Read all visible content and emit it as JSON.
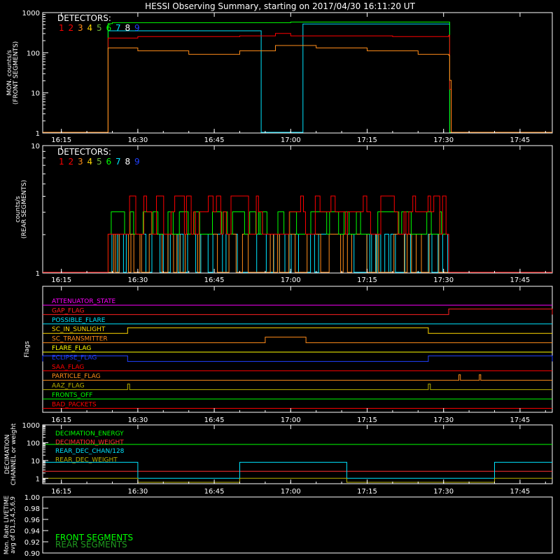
{
  "title": "HESSI Observing Summary, starting on 2017/04/30 16:11:20 UT",
  "time_axis": {
    "start": "16:11:20",
    "end": "17:51:20",
    "tick_times": [
      "16:15",
      "16:30",
      "16:45",
      "17:00",
      "17:15",
      "17:30",
      "17:45"
    ]
  },
  "detector_palette": [
    "#ff0000",
    "#ff0000",
    "#ff8c1a",
    "#ffd700",
    "#6db83c",
    "#00ff00",
    "#00e5ff",
    "#ffffff",
    "#2040ff"
  ],
  "chart_data": [
    {
      "name": "front",
      "type": "line",
      "ylabel": "MON. counts/s",
      "ylabel2": "(FRONT SEGMENTS)",
      "yscale": "log",
      "ylim": [
        1,
        1000
      ],
      "tick_labels": [
        "1",
        "10",
        "100",
        "1000"
      ],
      "legend_title": "DETECTORS:",
      "legend": [
        "1",
        "2",
        "3",
        "4",
        "5",
        "6",
        "7",
        "8",
        "9"
      ],
      "series": [
        {
          "color": "#00e5ff",
          "points": [
            [
              "16:11:20",
              1
            ],
            [
              "16:23:50",
              1
            ],
            [
              "16:24:10",
              350
            ],
            [
              "16:54",
              350
            ],
            [
              "16:54.2",
              1
            ],
            [
              "17:02.2",
              1
            ],
            [
              "17:02.4",
              520
            ],
            [
              "17:31",
              520
            ],
            [
              "17:31.2",
              1
            ],
            [
              "17:51:20",
              1
            ]
          ]
        },
        {
          "color": "#00ff00",
          "points": [
            [
              "16:11:20",
              1
            ],
            [
              "16:23:50",
              1
            ],
            [
              "16:24:10",
              530
            ],
            [
              "16:25",
              560
            ],
            [
              "17:00",
              580
            ],
            [
              "17:31",
              580
            ],
            [
              "17:31.2",
              1
            ],
            [
              "17:51:20",
              1
            ]
          ]
        },
        {
          "color": "#ff0000",
          "points": [
            [
              "16:11:20",
              1
            ],
            [
              "16:23:50",
              1
            ],
            [
              "16:24:10",
              230
            ],
            [
              "16:30",
              250
            ],
            [
              "16:50",
              260
            ],
            [
              "16:57",
              300
            ],
            [
              "17:00",
              260
            ],
            [
              "17:20",
              250
            ],
            [
              "17:31",
              270
            ],
            [
              "17:31.2",
              12
            ],
            [
              "17:31.5",
              1
            ],
            [
              "17:51:20",
              1
            ]
          ]
        },
        {
          "color": "#ff8c1a",
          "points": [
            [
              "16:11:20",
              1
            ],
            [
              "16:23:50",
              1
            ],
            [
              "16:24:10",
              130
            ],
            [
              "16:30",
              110
            ],
            [
              "16:40",
              90
            ],
            [
              "16:50",
              110
            ],
            [
              "16:57",
              150
            ],
            [
              "17:05",
              130
            ],
            [
              "17:15",
              110
            ],
            [
              "17:25",
              90
            ],
            [
              "17:31",
              85
            ],
            [
              "17:31.2",
              20
            ],
            [
              "17:31.5",
              1
            ],
            [
              "17:51:20",
              1
            ]
          ]
        }
      ]
    },
    {
      "name": "rear",
      "type": "line",
      "ylabel": "counts/s",
      "ylabel2": "(REAR SEGMENTS)",
      "yscale": "log",
      "ylim": [
        1,
        10
      ],
      "tick_labels": [
        "1",
        "10"
      ],
      "legend_title": "DETECTORS:",
      "legend": [
        "1",
        "2",
        "3",
        "4",
        "5",
        "6",
        "7",
        "8",
        "9"
      ],
      "start": "16:24:10",
      "end": "17:31",
      "levels": [
        1,
        2,
        3,
        4
      ],
      "series": [
        {
          "color": "#00e5ff",
          "base": 2
        },
        {
          "color": "#ff8c1a",
          "base": 2
        },
        {
          "color": "#00ff00",
          "base": 2
        },
        {
          "color": "#ff0000",
          "base": 2
        }
      ]
    },
    {
      "name": "flags",
      "type": "line",
      "ylabel": "Flags",
      "flags": [
        {
          "label": "ATTENUATOR_STATE",
          "color": "#ff00ff",
          "segments": []
        },
        {
          "label": "GAP_FLAG",
          "color": "#ff2020",
          "segments": [
            [
              "17:31",
              "17:51:20"
            ]
          ]
        },
        {
          "label": "POSSIBLE_FLARE",
          "color": "#00e5ff",
          "segments": []
        },
        {
          "label": "SC_IN_SUNLIGHT",
          "color": "#ffd700",
          "segments": [
            [
              "16:28",
              "17:27"
            ]
          ]
        },
        {
          "label": "SC_TRANSMITTER",
          "color": "#ff8c1a",
          "segments": [
            [
              "16:55",
              "17:03"
            ]
          ]
        },
        {
          "label": "FLARE_FLAG",
          "color": "#ffff00",
          "segments": []
        },
        {
          "label": "ECLIPSE_FLAG",
          "color": "#2040ff",
          "segments": [
            [
              "16:11:20",
              "16:28"
            ],
            [
              "17:27",
              "17:51:20"
            ]
          ]
        },
        {
          "label": "SAA_FLAG",
          "color": "#ff0000",
          "segments": []
        },
        {
          "label": "PARTICLE_FLAG",
          "color": "#ff8c1a",
          "segments": [
            [
              "17:33",
              "17:33.3"
            ],
            [
              "17:37",
              "17:37.3"
            ]
          ]
        },
        {
          "label": "AAZ_FLAG",
          "color": "#b8b000",
          "segments": [
            [
              "16:28",
              "16:28.4"
            ],
            [
              "17:27",
              "17:27.4"
            ]
          ]
        },
        {
          "label": "FRONTS_OFF",
          "color": "#00ff00",
          "segments": []
        },
        {
          "label": "BAD_PACKETS",
          "color": "#ff0000",
          "segments": []
        }
      ]
    },
    {
      "name": "decimation",
      "type": "line",
      "ylabel": "DECIMATION",
      "ylabel2": "CHANNEL or weight",
      "yscale": "log",
      "ylim": [
        0.5,
        1000
      ],
      "tick_labels": [
        "1",
        "10",
        "100",
        "1000"
      ],
      "legend": [
        {
          "label": "DECIMATION_ENERGY",
          "color": "#00ff00"
        },
        {
          "label": "DECIMATION_WEIGHT",
          "color": "#ff3030"
        },
        {
          "label": "REAR_DEC_CHAN/128",
          "color": "#00e5ff"
        },
        {
          "label": "REAR_DEC_WEIGHT",
          "color": "#b8b000"
        }
      ],
      "series": [
        {
          "color": "#00ff00",
          "points": [
            [
              "16:11:20",
              80
            ],
            [
              "17:51:20",
              80
            ]
          ]
        },
        {
          "color": "#ff3030",
          "points": [
            [
              "16:11:20",
              2.5
            ],
            [
              "17:51:20",
              2.5
            ]
          ]
        },
        {
          "color": "#00e5ff",
          "points": [
            [
              "16:11:20",
              8
            ],
            [
              "16:30",
              8
            ],
            [
              "16:30",
              1
            ],
            [
              "16:50",
              1
            ],
            [
              "16:50",
              8
            ],
            [
              "17:11",
              8
            ],
            [
              "17:11",
              1
            ],
            [
              "17:40",
              1
            ],
            [
              "17:40",
              8
            ],
            [
              "17:51:20",
              8
            ]
          ]
        },
        {
          "color": "#b8b000",
          "points": [
            [
              "16:11:20",
              1
            ],
            [
              "16:30",
              1
            ],
            [
              "16:30",
              0.6
            ],
            [
              "16:50",
              0.6
            ],
            [
              "16:50",
              1
            ],
            [
              "17:11",
              1
            ],
            [
              "17:11",
              0.6
            ],
            [
              "17:40",
              0.6
            ],
            [
              "17:40",
              1
            ],
            [
              "17:51:20",
              1
            ]
          ]
        }
      ]
    },
    {
      "name": "livetime",
      "type": "line",
      "ylabel": "Mon. Rate LIVETIME",
      "ylabel2": "avg of D1,3,4,5,6,9",
      "ylim": [
        0.9,
        1.0
      ],
      "tick_labels": [
        "0.90",
        "0.92",
        "0.94",
        "0.96",
        "0.98",
        "1.00"
      ],
      "legend": [
        {
          "label": "FRONT SEGMENTS",
          "color": "#00ff00"
        },
        {
          "label": "REAR SEGMENTS",
          "color": "#1f9a1f"
        }
      ],
      "series": []
    }
  ]
}
